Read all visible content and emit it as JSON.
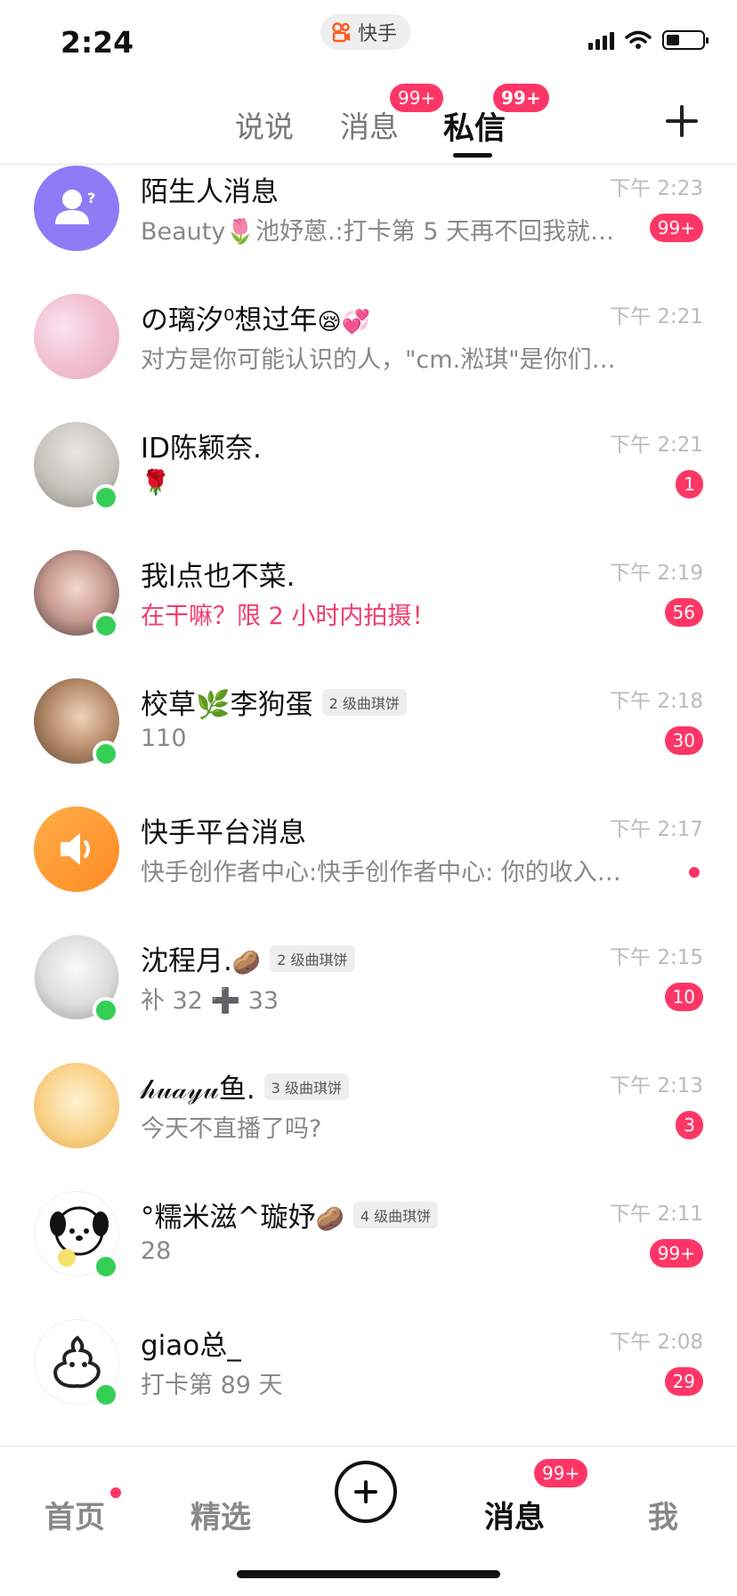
{
  "status_bar": {
    "time": "2:24",
    "app_label": "快手"
  },
  "tabs": [
    {
      "label": "说说",
      "badge": ""
    },
    {
      "label": "消息",
      "badge": "99+"
    },
    {
      "label": "私信",
      "badge": "99+"
    }
  ],
  "messages": [
    {
      "name": "陌生人消息",
      "time": "下午 2:23",
      "preview": "Beauty🌷池妤蒽.:打卡第 5 天再不回我就…",
      "badge": "99+",
      "level": "",
      "online": false,
      "avatar_icon": "stranger-icon"
    },
    {
      "name": "の璃汐⁰想过年",
      "name_emoji": "😪💞",
      "time": "下午 2:21",
      "preview": "对方是你可能认识的人，\"cm.淞琪\"是你们的…",
      "badge": "",
      "level": "",
      "online": false
    },
    {
      "name": "ID陈颖奈.",
      "time": "下午 2:21",
      "preview": "🌹",
      "badge": "1",
      "level": "",
      "online": true
    },
    {
      "name": "我l点也不菜.",
      "time": "下午 2:19",
      "preview": "在干嘛？限 2 小时内拍摄！",
      "badge": "56",
      "level": "",
      "online": true,
      "preview_highlight": true
    },
    {
      "name": "校草🌿李狗蛋",
      "time": "下午 2:18",
      "preview": "110",
      "badge": "30",
      "level": "2 级曲琪饼",
      "online": true
    },
    {
      "name": "快手平台消息",
      "time": "下午 2:17",
      "preview": "快手创作者中心:快手创作者中心: 你的收入…",
      "badge": "",
      "dot": true,
      "level": "",
      "online": false,
      "avatar_icon": "speaker-icon"
    },
    {
      "name": "沈程月.",
      "name_emoji": "🥔",
      "time": "下午 2:15",
      "preview": "补 32 ➕ 33",
      "badge": "10",
      "level": "2 级曲琪饼",
      "online": true
    },
    {
      "name": "𝒽𝓊𝒶𝓎𝓊鱼.",
      "time": "下午 2:13",
      "preview": "今天不直播了吗?",
      "badge": "3",
      "level": "3 级曲琪饼",
      "online": false
    },
    {
      "name": "°糯米滋^璇妤",
      "name_emoji": "🥔",
      "time": "下午 2:11",
      "preview": "28",
      "badge": "99+",
      "level": "4 级曲琪饼",
      "online": true
    },
    {
      "name": "giao总_",
      "time": "下午 2:08",
      "preview": "打卡第 89 天",
      "badge": "29",
      "level": "",
      "online": true
    }
  ],
  "bottom_nav": [
    {
      "label": "首页",
      "dot": true
    },
    {
      "label": "精选"
    },
    {
      "label": "消息",
      "badge": "99+",
      "active": true
    },
    {
      "label": "我"
    }
  ],
  "colors": {
    "accent": "#fe3666",
    "online": "#35cf56",
    "stranger_avatar": "#8f7bf5",
    "platform_avatar": "#ff9a2f"
  }
}
